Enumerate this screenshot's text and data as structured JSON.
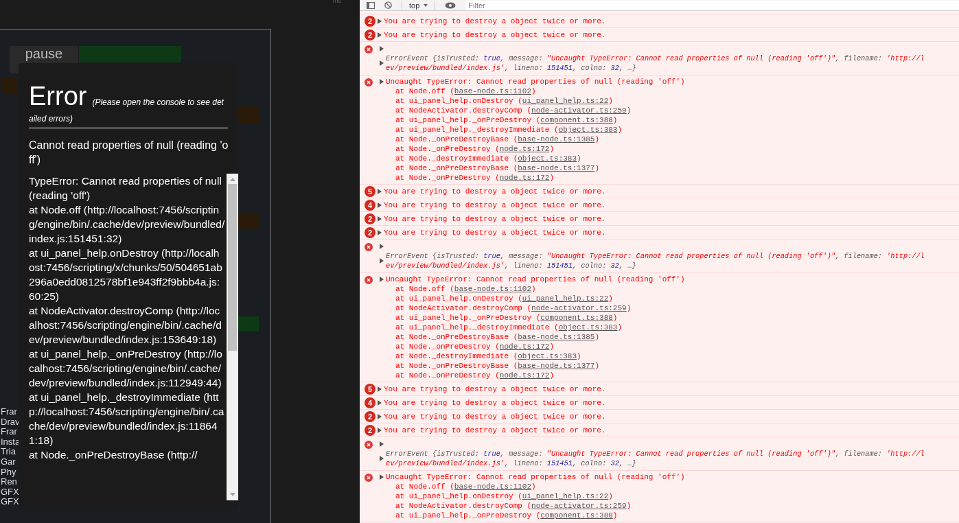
{
  "top_bar": {
    "text": "ms"
  },
  "game": {
    "pause_button": "pause",
    "stats": [
      "Frar",
      "Drav",
      "Frar",
      "Insta",
      "Tria",
      "Gar",
      "Phy",
      "Ren",
      "GFX",
      "GFX"
    ]
  },
  "error_dialog": {
    "title": "Error",
    "subtitle": "(Please open the console to see detailed errors)",
    "message": "Cannot read properties of null (reading 'off')",
    "stack": [
      "TypeError: Cannot read properties of null (reading 'off')",
      "at Node.off (http://localhost:7456/scripting/engine/bin/.cache/dev/preview/bundled/index.js:151451:32)",
      "at ui_panel_help.onDestroy (http://localhost:7456/scripting/x/chunks/50/504651ab296a0edd0812578bf1e943ff2f9bbb4a.js:60:25)",
      "at NodeActivator.destroyComp (http://localhost:7456/scripting/engine/bin/.cache/dev/preview/bundled/index.js:153649:18)",
      "at ui_panel_help._onPreDestroy (http://localhost:7456/scripting/engine/bin/.cache/dev/preview/bundled/index.js:112949:44)",
      "at ui_panel_help._destroyImmediate (http://localhost:7456/scripting/engine/bin/.cache/dev/preview/bundled/index.js:118641:18)",
      "at Node._onPreDestroyBase (http://"
    ]
  },
  "console": {
    "toolbar": {
      "context": "top",
      "filter_placeholder": "Filter"
    },
    "entries": [
      {
        "kind": "repeat",
        "count": "2",
        "text": "You are trying to destroy a object twice or more."
      },
      {
        "kind": "repeat",
        "count": "2",
        "text": "You are trying to destroy a object twice or more."
      },
      {
        "kind": "event",
        "lines": [
          [
            {
              "kind": "plain",
              "s": "ErrorEvent {isTrusted: "
            },
            {
              "kind": "keyword",
              "s": "true"
            },
            {
              "kind": "plain",
              "s": ", message: "
            },
            {
              "kind": "string",
              "s": "\"Uncaught TypeError: Cannot read properties of null (reading 'off')\""
            },
            {
              "kind": "plain",
              "s": ", filename: "
            },
            {
              "kind": "string",
              "s": "'http://l"
            }
          ],
          [
            {
              "kind": "string",
              "s": "ev/preview/bundled/index.js'"
            },
            {
              "kind": "plain",
              "s": ", lineno: "
            },
            {
              "kind": "number",
              "s": "151451"
            },
            {
              "kind": "plain",
              "s": ", colno: "
            },
            {
              "kind": "number",
              "s": "32"
            },
            {
              "kind": "plain",
              "s": ", …}"
            }
          ]
        ]
      },
      {
        "kind": "stack",
        "text": "Uncaught TypeError: Cannot read properties of null (reading 'off')",
        "frames": [
          {
            "at": "at Node.off (",
            "file": "base-node.ts:1102",
            "end": ")"
          },
          {
            "at": "at ui_panel_help.onDestroy (",
            "file": "ui_panel_help.ts:22",
            "end": ")"
          },
          {
            "at": "at NodeActivator.destroyComp (",
            "file": "node-activator.ts:259",
            "end": ")"
          },
          {
            "at": "at ui_panel_help._onPreDestroy (",
            "file": "component.ts:388",
            "end": ")"
          },
          {
            "at": "at ui_panel_help._destroyImmediate (",
            "file": "object.ts:383",
            "end": ")"
          },
          {
            "at": "at Node._onPreDestroyBase (",
            "file": "base-node.ts:1385",
            "end": ")"
          },
          {
            "at": "at Node._onPreDestroy (",
            "file": "node.ts:172",
            "end": ")"
          },
          {
            "at": "at Node._destroyImmediate (",
            "file": "object.ts:383",
            "end": ")"
          },
          {
            "at": "at Node._onPreDestroyBase (",
            "file": "base-node.ts:1377",
            "end": ")"
          },
          {
            "at": "at Node._onPreDestroy (",
            "file": "node.ts:172",
            "end": ")"
          }
        ]
      },
      {
        "kind": "repeat",
        "count": "5",
        "text": "You are trying to destroy a object twice or more."
      },
      {
        "kind": "repeat",
        "count": "4",
        "text": "You are trying to destroy a object twice or more."
      },
      {
        "kind": "repeat",
        "count": "2",
        "text": "You are trying to destroy a object twice or more."
      },
      {
        "kind": "repeat",
        "count": "2",
        "text": "You are trying to destroy a object twice or more."
      },
      {
        "kind": "event",
        "lines": [
          [
            {
              "kind": "plain",
              "s": "ErrorEvent {isTrusted: "
            },
            {
              "kind": "keyword",
              "s": "true"
            },
            {
              "kind": "plain",
              "s": ", message: "
            },
            {
              "kind": "string",
              "s": "\"Uncaught TypeError: Cannot read properties of null (reading 'off')\""
            },
            {
              "kind": "plain",
              "s": ", filename: "
            },
            {
              "kind": "string",
              "s": "'http://l"
            }
          ],
          [
            {
              "kind": "string",
              "s": "ev/preview/bundled/index.js'"
            },
            {
              "kind": "plain",
              "s": ", lineno: "
            },
            {
              "kind": "number",
              "s": "151451"
            },
            {
              "kind": "plain",
              "s": ", colno: "
            },
            {
              "kind": "number",
              "s": "32"
            },
            {
              "kind": "plain",
              "s": ", …}"
            }
          ]
        ]
      },
      {
        "kind": "stack",
        "text": "Uncaught TypeError: Cannot read properties of null (reading 'off')",
        "frames": [
          {
            "at": "at Node.off (",
            "file": "base-node.ts:1102",
            "end": ")"
          },
          {
            "at": "at ui_panel_help.onDestroy (",
            "file": "ui_panel_help.ts:22",
            "end": ")"
          },
          {
            "at": "at NodeActivator.destroyComp (",
            "file": "node-activator.ts:259",
            "end": ")"
          },
          {
            "at": "at ui_panel_help._onPreDestroy (",
            "file": "component.ts:388",
            "end": ")"
          },
          {
            "at": "at ui_panel_help._destroyImmediate (",
            "file": "object.ts:383",
            "end": ")"
          },
          {
            "at": "at Node._onPreDestroyBase (",
            "file": "base-node.ts:1385",
            "end": ")"
          },
          {
            "at": "at Node._onPreDestroy (",
            "file": "node.ts:172",
            "end": ")"
          },
          {
            "at": "at Node._destroyImmediate (",
            "file": "object.ts:383",
            "end": ")"
          },
          {
            "at": "at Node._onPreDestroyBase (",
            "file": "base-node.ts:1377",
            "end": ")"
          },
          {
            "at": "at Node._onPreDestroy (",
            "file": "node.ts:172",
            "end": ")"
          }
        ]
      },
      {
        "kind": "repeat",
        "count": "5",
        "text": "You are trying to destroy a object twice or more."
      },
      {
        "kind": "repeat",
        "count": "4",
        "text": "You are trying to destroy a object twice or more."
      },
      {
        "kind": "repeat",
        "count": "2",
        "text": "You are trying to destroy a object twice or more."
      },
      {
        "kind": "repeat",
        "count": "2",
        "text": "You are trying to destroy a object twice or more."
      },
      {
        "kind": "event",
        "lines": [
          [
            {
              "kind": "plain",
              "s": "ErrorEvent {isTrusted: "
            },
            {
              "kind": "keyword",
              "s": "true"
            },
            {
              "kind": "plain",
              "s": ", message: "
            },
            {
              "kind": "string",
              "s": "\"Uncaught TypeError: Cannot read properties of null (reading 'off')\""
            },
            {
              "kind": "plain",
              "s": ", filename: "
            },
            {
              "kind": "string",
              "s": "'http://l"
            }
          ],
          [
            {
              "kind": "string",
              "s": "ev/preview/bundled/index.js'"
            },
            {
              "kind": "plain",
              "s": ", lineno: "
            },
            {
              "kind": "number",
              "s": "151451"
            },
            {
              "kind": "plain",
              "s": ", colno: "
            },
            {
              "kind": "number",
              "s": "32"
            },
            {
              "kind": "plain",
              "s": ", …}"
            }
          ]
        ]
      },
      {
        "kind": "stack",
        "text": "Uncaught TypeError: Cannot read properties of null (reading 'off')",
        "frames": [
          {
            "at": "at Node.off (",
            "file": "base-node.ts:1102",
            "end": ")"
          },
          {
            "at": "at ui_panel_help.onDestroy (",
            "file": "ui_panel_help.ts:22",
            "end": ")"
          },
          {
            "at": "at NodeActivator.destroyComp (",
            "file": "node-activator.ts:259",
            "end": ")"
          },
          {
            "at": "at ui_panel_help._onPreDestroy (",
            "file": "component.ts:388",
            "end": ")"
          }
        ]
      }
    ]
  }
}
